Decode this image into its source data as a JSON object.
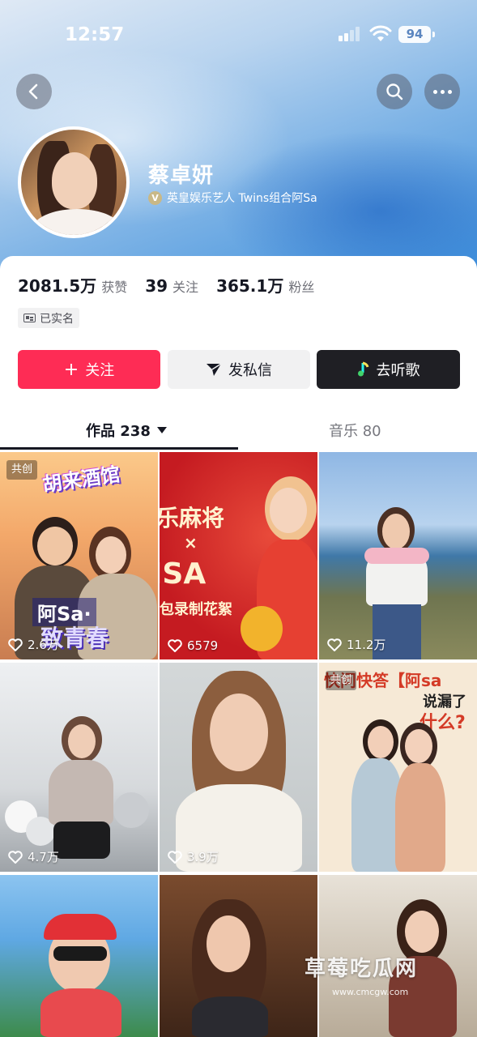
{
  "status_bar": {
    "time": "12:57",
    "battery": "94"
  },
  "profile": {
    "name": "蔡卓妍",
    "verification": "英皇娱乐艺人 Twins组合阿Sa",
    "verify_badge": "V"
  },
  "stats": [
    {
      "value": "2081.5万",
      "label": "获赞"
    },
    {
      "value": "39",
      "label": "关注"
    },
    {
      "value": "365.1万",
      "label": "粉丝"
    }
  ],
  "realname_badge": "已实名",
  "actions": {
    "follow": "关注",
    "follow_plus": "+",
    "message": "发私信",
    "listen": "去听歌"
  },
  "tabs": {
    "works": "作品 238",
    "music": "音乐 80"
  },
  "videos": [
    {
      "likes": "2.6万",
      "tag": "共创",
      "title_top": "胡来酒馆",
      "caption_1": "阿Sa·",
      "caption_2": "致青春"
    },
    {
      "likes": "6579",
      "caption_1": "乐麻将",
      "caption_2": "×",
      "caption_3": "ISA",
      "caption_4": "包录制花絮"
    },
    {
      "likes": "11.2万"
    },
    {
      "likes": "4.7万"
    },
    {
      "likes": "3.9万"
    },
    {
      "likes": "",
      "tag": "共创",
      "caption_1": "快问快答【阿sa",
      "caption_2": "说漏了",
      "caption_3": "什么?"
    },
    {
      "likes": ""
    },
    {
      "likes": ""
    },
    {
      "likes": ""
    }
  ],
  "watermark": {
    "text": "草莓吃瓜网",
    "url": "www.cmcgw.com"
  },
  "colors": {
    "accent": "#fe2c55",
    "dark_button": "#1f1f24"
  }
}
